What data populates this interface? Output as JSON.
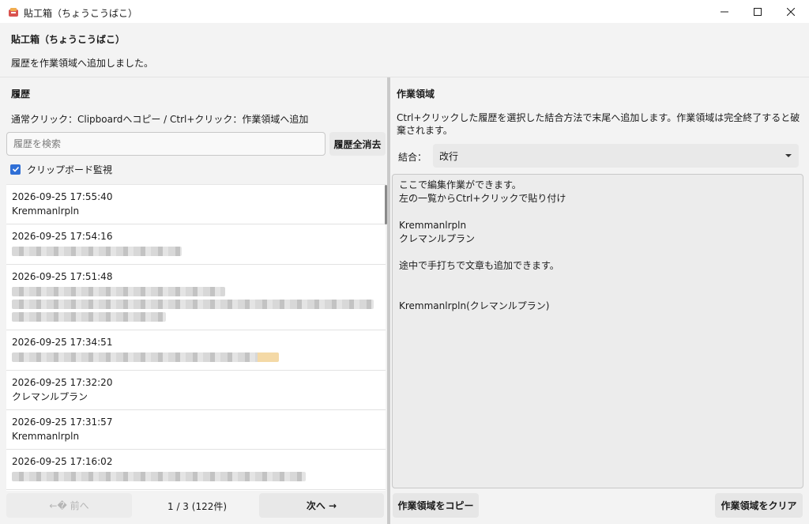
{
  "window": {
    "title": "貼工箱（ちょうこうばこ）",
    "controls": {
      "minimize": "minimize-icon",
      "maximize": "maximize-icon",
      "close": "close-icon"
    }
  },
  "header": {
    "app_title": "貼工箱（ちょうこうばこ）",
    "status": "履歴を作業領域へ追加しました。"
  },
  "history": {
    "title": "履歴",
    "hint": "通常クリック：Clipboardへコピー / Ctrl+クリック：作業領域へ追加",
    "search_placeholder": "履歴を検索",
    "search_value": "",
    "clear_all_label": "履歴全消去",
    "monitor_label": "クリップボード監視",
    "monitor_checked": true,
    "items": [
      {
        "timestamp": "2026-09-25 17:55:40",
        "text": "Kremmanlrpln"
      },
      {
        "timestamp": "2026-09-25 17:54:16",
        "text": "",
        "blurred_lines": 1
      },
      {
        "timestamp": "2026-09-25 17:51:48",
        "text": "",
        "blurred_lines": 3
      },
      {
        "timestamp": "2026-09-25 17:34:51",
        "text": "",
        "blurred_lines": 1
      },
      {
        "timestamp": "2026-09-25 17:32:20",
        "text": "クレマンルプラン"
      },
      {
        "timestamp": "2026-09-25 17:31:57",
        "text": "Kremmanlrpln"
      },
      {
        "timestamp": "2026-09-25 17:16:02",
        "text": "",
        "blurred_lines": 1
      }
    ],
    "pager": {
      "prev_label": "←� 前へ",
      "info": "1 / 3 (122件)",
      "next_label": "次へ →"
    }
  },
  "workspace": {
    "title": "作業領域",
    "hint": "Ctrl+クリックした履歴を選択した結合方法で末尾へ追加します。作業領域は完全終了すると破棄されます。",
    "combine_label": "結合：",
    "combine_value": "改行",
    "text": "ここで編集作業ができます。\n左の一覧からCtrl+クリックで貼り付け\n\nKremmanlrpln\nクレマンルプラン\n\n途中で手打ちで文章も追加できます。\n\n\nKremmanlrpln(クレマンルプラン)",
    "copy_label": "作業領域をコピー",
    "clear_label": "作業領域をクリア"
  },
  "colors": {
    "accent": "#2f6fd6",
    "background": "#f3f3f3",
    "panel": "#ffffff"
  }
}
